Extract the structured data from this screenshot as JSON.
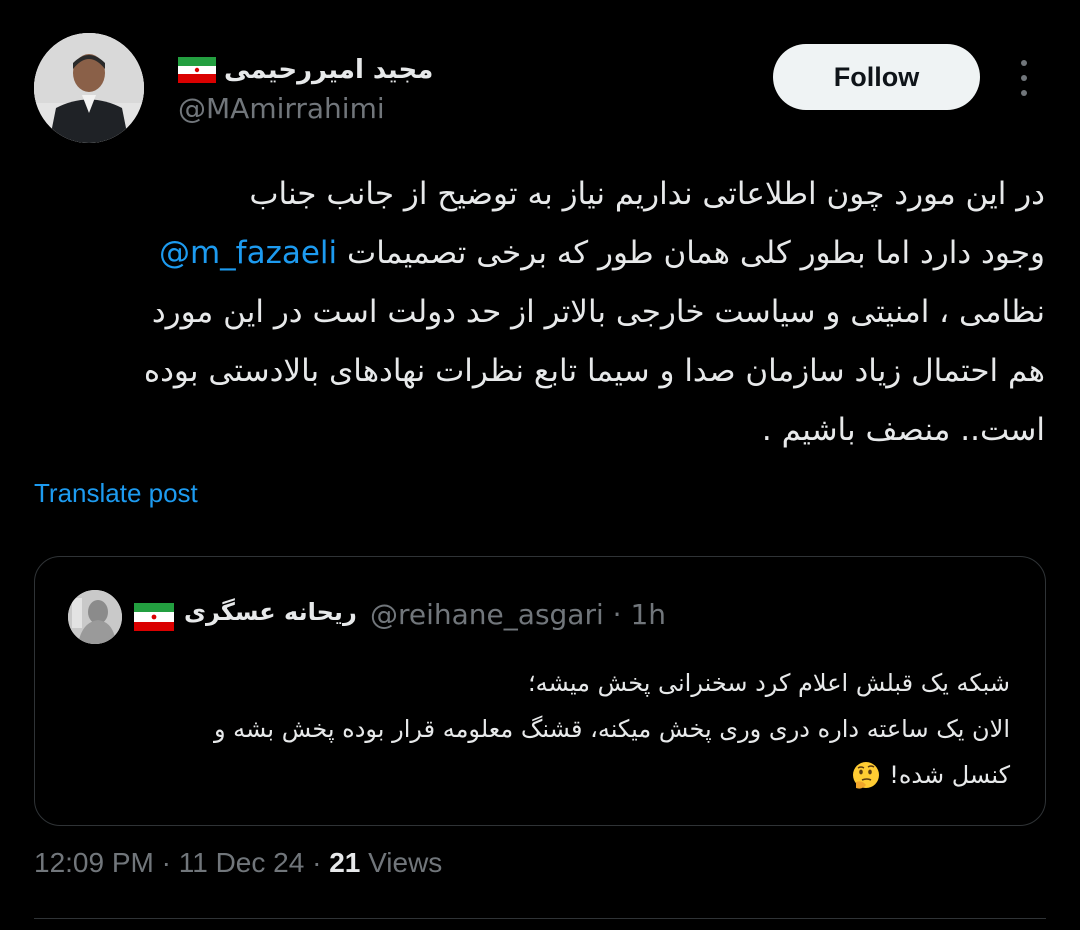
{
  "author": {
    "display_name": "مجید امیررحیمی",
    "handle": "@MAmirrahimi",
    "flag_icon": "iran-flag-icon"
  },
  "follow_label": "Follow",
  "more_icon": "more-dots-icon",
  "tweet": {
    "lines": [
      "در این مورد چون اطلاعاتی نداریم نیاز به توضیح از جانب جناب",
      "وجود دارد اما بطور کلی همان طور که برخی تصمیمات",
      "نظامی ، امنیتی و سیاست خارجی بالاتر از حد دولت است در این مورد",
      "هم احتمال زیاد سازمان صدا و سیما تابع نظرات نهادهای بالادستی بوده",
      "است.. منصف باشیم ."
    ],
    "mention": "@m_fazaeli"
  },
  "translate_label": "Translate post",
  "quote": {
    "display_name": "ریحانه عسگری",
    "handle_time": "@reihane_asgari · 1h",
    "lines": [
      "شبکه یک قبلش اعلام کرد سخنرانی پخش میشه؛",
      "الان یک ساعته داره دری وری پخش میکنه، قشنگ معلومه قرار بوده پخش بشه و",
      "کنسل شده!"
    ],
    "emoji_icon": "thinking-face-icon"
  },
  "meta": {
    "time_date": "12:09 PM · 11 Dec 24 · ",
    "views_count": "21",
    "views_label": " Views"
  },
  "colors": {
    "background": "#000000",
    "text": "#e7e9ea",
    "muted": "#71767b",
    "link": "#1d9bf0",
    "border": "#2f3336"
  }
}
